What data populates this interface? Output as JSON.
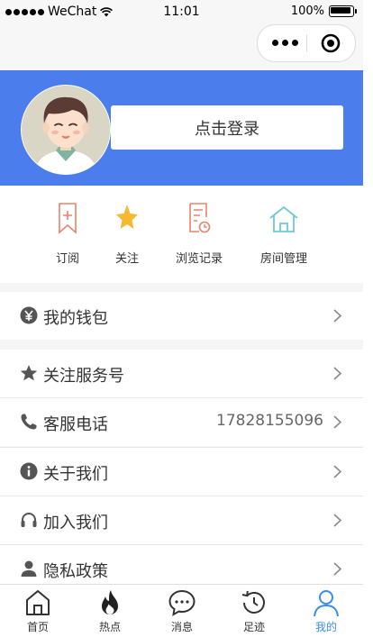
{
  "status_bar": {
    "carrier": "WeChat",
    "time": "11:01",
    "battery": "100%"
  },
  "header": {
    "login_label": "点击登录"
  },
  "quick_actions": [
    {
      "label": "订阅",
      "icon": "bookmark-add-icon",
      "color": "#e8836b"
    },
    {
      "label": "关注",
      "icon": "star-icon",
      "color": "#f5b92f"
    },
    {
      "label": "浏览记录",
      "icon": "history-doc-icon",
      "color": "#e8836b"
    },
    {
      "label": "房间管理",
      "icon": "house-icon",
      "color": "#6ec9d6"
    }
  ],
  "wallet": {
    "label": "我的钱包",
    "icon": "yen-icon"
  },
  "menu": [
    {
      "label": "关注服务号",
      "icon": "star-icon",
      "value": ""
    },
    {
      "label": "客服电话",
      "icon": "phone-icon",
      "value": "17828155096"
    },
    {
      "label": "关于我们",
      "icon": "info-icon",
      "value": ""
    },
    {
      "label": "加入我们",
      "icon": "headphones-icon",
      "value": ""
    },
    {
      "label": "隐私政策",
      "icon": "user-icon",
      "value": ""
    }
  ],
  "tabs": [
    {
      "label": "首页",
      "icon": "home-icon",
      "active": false
    },
    {
      "label": "热点",
      "icon": "fire-icon",
      "active": false
    },
    {
      "label": "消息",
      "icon": "message-icon",
      "active": false
    },
    {
      "label": "足迹",
      "icon": "history-icon",
      "active": false
    },
    {
      "label": "我的",
      "icon": "profile-icon",
      "active": true
    }
  ],
  "colors": {
    "header_bg": "#4b7ded",
    "active_tab": "#3b8df0",
    "icon_gray": "#555555"
  }
}
